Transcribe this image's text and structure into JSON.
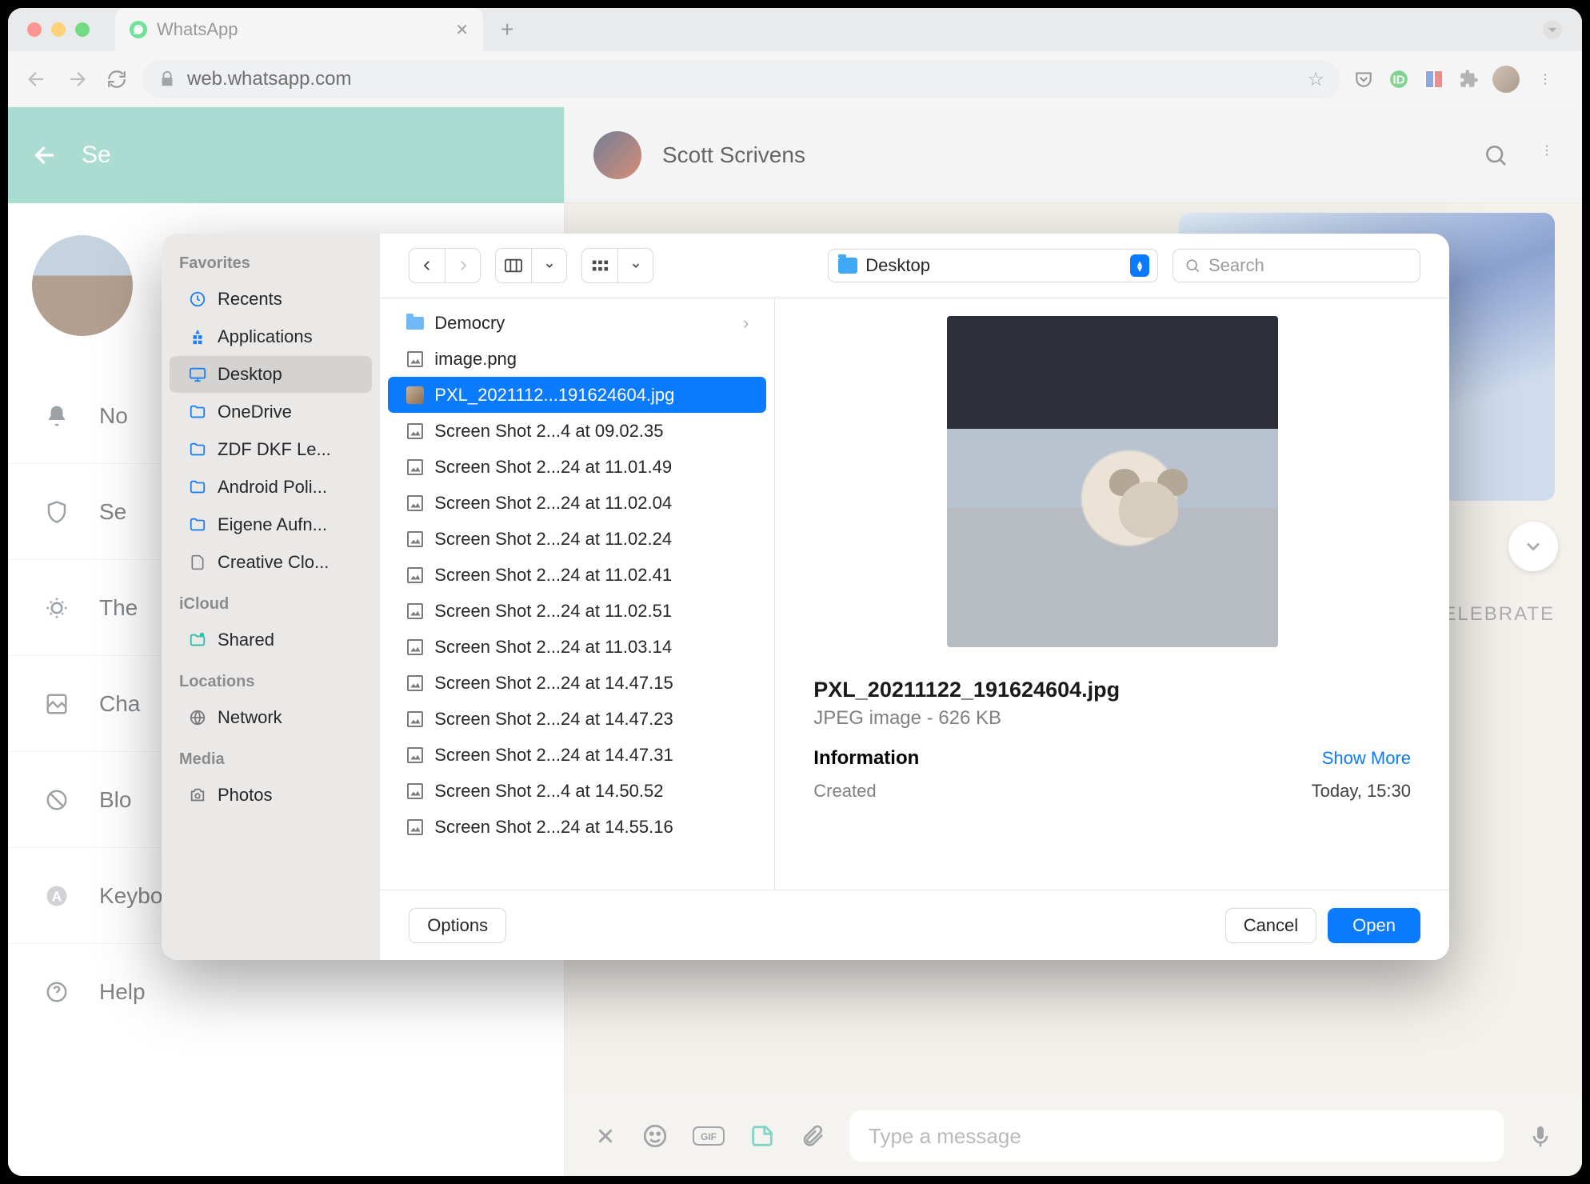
{
  "browser": {
    "tab_title": "WhatsApp",
    "url_host": "web.whatsapp.com",
    "icons": {
      "back": "‹",
      "fwd": "›",
      "reload": "⟳"
    }
  },
  "chat": {
    "contact_name": "Scott Scrivens",
    "celebrate": "CELEBRATE",
    "composer_placeholder": "Type a message"
  },
  "settings": {
    "title": "Se",
    "rows": [
      {
        "icon": "bell",
        "label": "No"
      },
      {
        "icon": "shield",
        "label": "Se"
      },
      {
        "icon": "theme",
        "label": "The"
      },
      {
        "icon": "wallpaper",
        "label": "Cha"
      },
      {
        "icon": "block",
        "label": "Blo"
      },
      {
        "icon": "keyboard",
        "label": "Keyboard shortcuts"
      },
      {
        "icon": "help",
        "label": "Help"
      }
    ]
  },
  "filedialog": {
    "location": "Desktop",
    "search_placeholder": "Search",
    "sidebar": {
      "favorites_label": "Favorites",
      "favorites": [
        {
          "icon": "recents",
          "label": "Recents"
        },
        {
          "icon": "apps",
          "label": "Applications"
        },
        {
          "icon": "desktop",
          "label": "Desktop",
          "selected": true
        },
        {
          "icon": "folder",
          "label": "OneDrive"
        },
        {
          "icon": "folder",
          "label": "ZDF DKF Le..."
        },
        {
          "icon": "folder",
          "label": "Android Poli..."
        },
        {
          "icon": "folder",
          "label": "Eigene Aufn..."
        },
        {
          "icon": "file",
          "label": "Creative Clo..."
        }
      ],
      "icloud_label": "iCloud",
      "icloud": [
        {
          "icon": "shared",
          "label": "Shared"
        }
      ],
      "locations_label": "Locations",
      "locations": [
        {
          "icon": "network",
          "label": "Network"
        }
      ],
      "media_label": "Media",
      "media": [
        {
          "icon": "photos",
          "label": "Photos"
        }
      ]
    },
    "files": [
      {
        "type": "folder",
        "name": "Democry",
        "chev": true
      },
      {
        "type": "img",
        "name": "image.png"
      },
      {
        "type": "thumb",
        "name": "PXL_2021112...191624604.jpg",
        "selected": true
      },
      {
        "type": "img",
        "name": "Screen Shot 2...4 at 09.02.35"
      },
      {
        "type": "img",
        "name": "Screen Shot 2...24 at 11.01.49"
      },
      {
        "type": "img",
        "name": "Screen Shot 2...24 at 11.02.04"
      },
      {
        "type": "img",
        "name": "Screen Shot 2...24 at 11.02.24"
      },
      {
        "type": "img",
        "name": "Screen Shot 2...24 at 11.02.41"
      },
      {
        "type": "img",
        "name": "Screen Shot 2...24 at 11.02.51"
      },
      {
        "type": "img",
        "name": "Screen Shot 2...24 at 11.03.14"
      },
      {
        "type": "img",
        "name": "Screen Shot 2...24 at 14.47.15"
      },
      {
        "type": "img",
        "name": "Screen Shot 2...24 at 14.47.23"
      },
      {
        "type": "img",
        "name": "Screen Shot 2...24 at 14.47.31"
      },
      {
        "type": "img",
        "name": "Screen Shot 2...4 at 14.50.52"
      },
      {
        "type": "img",
        "name": "Screen Shot 2...24 at 14.55.16"
      }
    ],
    "preview": {
      "filename": "PXL_20211122_191624604.jpg",
      "kind": "JPEG image - 626 KB",
      "info_label": "Information",
      "show_more": "Show More",
      "created_label": "Created",
      "created_value": "Today, 15:30"
    },
    "buttons": {
      "options": "Options",
      "cancel": "Cancel",
      "open": "Open"
    }
  }
}
